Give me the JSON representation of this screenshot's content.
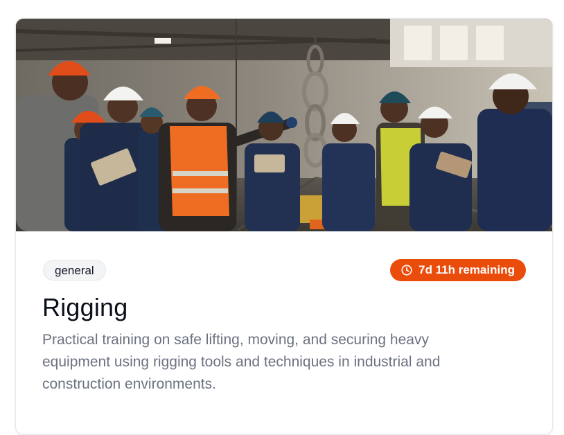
{
  "course": {
    "category": "general",
    "time_remaining": "7d 11h remaining",
    "title": "Rigging",
    "description": "Practical training on safe lifting, moving, and securing heavy equipment using rigging tools and techniques in industrial and construction environments."
  },
  "icons": {
    "timer": "clock-icon"
  },
  "colors": {
    "timer_badge": "#ea4c0c",
    "tag_bg": "#f3f4f6",
    "title": "#0b0f19",
    "description": "#6b7280"
  }
}
